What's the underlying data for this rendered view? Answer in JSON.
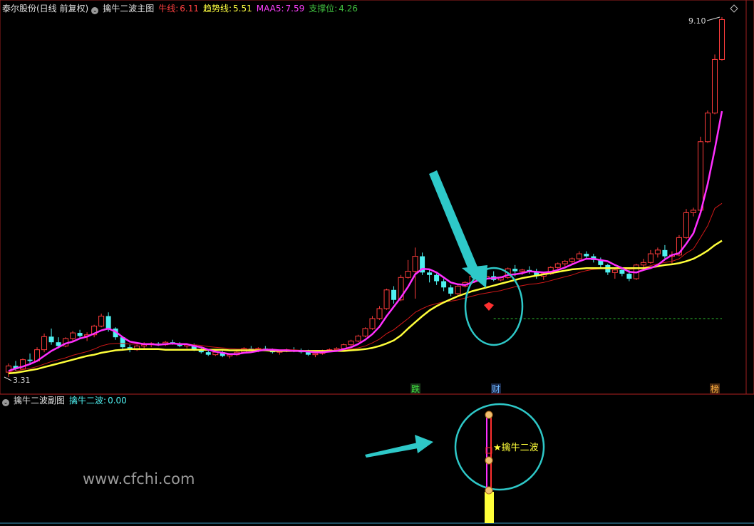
{
  "main_header": {
    "stock": "泰尔股份(日线 前复权)",
    "indicator": "擒牛二波主图",
    "niu_label": "牛线:",
    "niu_value": "6.11",
    "trend_label": "趋势线:",
    "trend_value": "5.51",
    "maa5_label": "MAA5:",
    "maa5_value": "7.59",
    "support_label": "支撑位:",
    "support_value": "4.26"
  },
  "sub_header": {
    "indicator": "擒牛二波副图",
    "value_label": "擒牛二波:",
    "value": "0.00"
  },
  "annotations": {
    "high_label": "9.10",
    "low_label": "3.31",
    "marker_die": "跌",
    "marker_cai": "财",
    "marker_bang": "榜",
    "star_label": "★擒牛二波"
  },
  "watermark": "www.cfchi.com",
  "colors": {
    "up": "#ff3c3c",
    "down": "#4ff0f0",
    "maa5": "#ff2fff",
    "trend": "#ffff3a",
    "niu": "#d01818",
    "support": "#30c030",
    "circle": "#2ec8c8"
  },
  "chart_data": {
    "type": "candlestick",
    "price_range": [
      3.31,
      9.1
    ],
    "support_level": 4.26,
    "ohlc": [
      [
        3.4,
        3.54,
        3.32,
        3.5
      ],
      [
        3.5,
        3.58,
        3.42,
        3.45
      ],
      [
        3.45,
        3.62,
        3.44,
        3.6
      ],
      [
        3.6,
        3.7,
        3.52,
        3.58
      ],
      [
        3.58,
        3.8,
        3.56,
        3.76
      ],
      [
        3.76,
        4.02,
        3.72,
        3.97
      ],
      [
        3.97,
        4.1,
        3.84,
        3.88
      ],
      [
        3.88,
        3.96,
        3.78,
        3.82
      ],
      [
        3.82,
        3.96,
        3.8,
        3.94
      ],
      [
        3.94,
        4.06,
        3.9,
        4.03
      ],
      [
        4.03,
        4.08,
        3.94,
        3.98
      ],
      [
        3.98,
        4.04,
        3.9,
        4.0
      ],
      [
        4.0,
        4.16,
        3.96,
        4.14
      ],
      [
        4.14,
        4.34,
        4.12,
        4.3
      ],
      [
        4.3,
        4.36,
        4.05,
        4.1
      ],
      [
        4.1,
        4.12,
        3.92,
        3.96
      ],
      [
        3.96,
        3.98,
        3.76,
        3.8
      ],
      [
        3.8,
        3.84,
        3.72,
        3.76
      ],
      [
        3.76,
        3.84,
        3.74,
        3.82
      ],
      [
        3.82,
        3.88,
        3.78,
        3.84
      ],
      [
        3.84,
        3.88,
        3.8,
        3.86
      ],
      [
        3.86,
        3.88,
        3.82,
        3.84
      ],
      [
        3.84,
        3.9,
        3.82,
        3.88
      ],
      [
        3.88,
        3.92,
        3.84,
        3.86
      ],
      [
        3.86,
        3.88,
        3.8,
        3.82
      ],
      [
        3.82,
        3.86,
        3.78,
        3.84
      ],
      [
        3.84,
        3.86,
        3.74,
        3.76
      ],
      [
        3.76,
        3.8,
        3.7,
        3.72
      ],
      [
        3.72,
        3.76,
        3.66,
        3.68
      ],
      [
        3.68,
        3.74,
        3.66,
        3.72
      ],
      [
        3.72,
        3.74,
        3.64,
        3.66
      ],
      [
        3.66,
        3.7,
        3.62,
        3.68
      ],
      [
        3.68,
        3.74,
        3.66,
        3.72
      ],
      [
        3.72,
        3.8,
        3.7,
        3.78
      ],
      [
        3.78,
        3.82,
        3.74,
        3.76
      ],
      [
        3.76,
        3.8,
        3.72,
        3.78
      ],
      [
        3.78,
        3.82,
        3.74,
        3.75
      ],
      [
        3.75,
        3.78,
        3.7,
        3.72
      ],
      [
        3.72,
        3.76,
        3.68,
        3.74
      ],
      [
        3.74,
        3.78,
        3.72,
        3.76
      ],
      [
        3.76,
        3.8,
        3.72,
        3.74
      ],
      [
        3.74,
        3.78,
        3.7,
        3.72
      ],
      [
        3.72,
        3.76,
        3.66,
        3.68
      ],
      [
        3.68,
        3.72,
        3.64,
        3.7
      ],
      [
        3.7,
        3.76,
        3.68,
        3.74
      ],
      [
        3.74,
        3.78,
        3.72,
        3.76
      ],
      [
        3.76,
        3.8,
        3.74,
        3.78
      ],
      [
        3.78,
        3.86,
        3.76,
        3.84
      ],
      [
        3.84,
        3.92,
        3.82,
        3.9
      ],
      [
        3.9,
        4.0,
        3.88,
        3.98
      ],
      [
        3.98,
        4.12,
        3.96,
        4.1
      ],
      [
        4.1,
        4.3,
        4.08,
        4.26
      ],
      [
        4.26,
        4.46,
        4.24,
        4.42
      ],
      [
        4.42,
        4.74,
        4.4,
        4.72
      ],
      [
        4.72,
        4.78,
        4.5,
        4.56
      ],
      [
        4.56,
        4.96,
        4.54,
        4.92
      ],
      [
        4.92,
        5.2,
        4.9,
        5.02
      ],
      [
        5.02,
        5.4,
        4.58,
        5.26
      ],
      [
        5.26,
        5.32,
        4.96,
        5.0
      ],
      [
        5.0,
        5.04,
        4.84,
        4.96
      ],
      [
        4.96,
        4.98,
        4.8,
        4.86
      ],
      [
        4.86,
        4.9,
        4.7,
        4.76
      ],
      [
        4.76,
        4.8,
        4.62,
        4.66
      ],
      [
        4.66,
        4.8,
        4.64,
        4.78
      ],
      [
        4.78,
        4.86,
        4.76,
        4.84
      ],
      [
        4.84,
        4.96,
        4.82,
        4.94
      ],
      [
        4.94,
        4.98,
        4.86,
        4.9
      ],
      [
        4.9,
        4.96,
        4.88,
        4.94
      ],
      [
        4.94,
        5.02,
        4.86,
        4.88
      ],
      [
        4.88,
        4.94,
        4.86,
        4.92
      ],
      [
        4.92,
        5.08,
        4.9,
        5.06
      ],
      [
        5.06,
        5.12,
        4.94,
        5.02
      ],
      [
        5.02,
        5.06,
        4.96,
        5.04
      ],
      [
        5.04,
        5.1,
        4.98,
        5.02
      ],
      [
        5.02,
        5.06,
        4.9,
        4.94
      ],
      [
        4.94,
        5.0,
        4.88,
        4.98
      ],
      [
        4.98,
        5.1,
        4.96,
        5.08
      ],
      [
        5.08,
        5.16,
        5.06,
        5.14
      ],
      [
        5.14,
        5.2,
        5.1,
        5.18
      ],
      [
        5.18,
        5.24,
        5.14,
        5.22
      ],
      [
        5.22,
        5.34,
        5.2,
        5.3
      ],
      [
        5.3,
        5.34,
        5.22,
        5.26
      ],
      [
        5.26,
        5.3,
        5.16,
        5.2
      ],
      [
        5.2,
        5.24,
        5.08,
        5.12
      ],
      [
        5.12,
        5.14,
        4.96,
        5.0
      ],
      [
        5.0,
        5.08,
        4.9,
        5.04
      ],
      [
        5.04,
        5.08,
        4.94,
        4.98
      ],
      [
        4.98,
        5.04,
        4.86,
        4.9
      ],
      [
        4.9,
        5.14,
        4.88,
        5.12
      ],
      [
        5.12,
        5.22,
        5.08,
        5.16
      ],
      [
        5.16,
        5.36,
        5.14,
        5.3
      ],
      [
        5.3,
        5.4,
        5.24,
        5.36
      ],
      [
        5.36,
        5.44,
        5.2,
        5.26
      ],
      [
        5.26,
        5.34,
        5.14,
        5.28
      ],
      [
        5.28,
        5.6,
        5.26,
        5.56
      ],
      [
        5.56,
        6.02,
        5.54,
        5.96
      ],
      [
        5.96,
        6.04,
        5.9,
        6.0
      ],
      [
        6.0,
        7.18,
        5.98,
        7.1
      ],
      [
        7.1,
        7.6,
        7.08,
        7.56
      ],
      [
        7.56,
        8.5,
        7.54,
        8.42
      ],
      [
        8.42,
        9.1,
        8.4,
        9.06
      ]
    ],
    "niu_line": [
      3.4,
      3.42,
      3.44,
      3.46,
      3.49,
      3.53,
      3.57,
      3.6,
      3.63,
      3.67,
      3.7,
      3.73,
      3.77,
      3.82,
      3.85,
      3.86,
      3.86,
      3.85,
      3.85,
      3.85,
      3.85,
      3.85,
      3.85,
      3.85,
      3.85,
      3.85,
      3.84,
      3.83,
      3.81,
      3.8,
      3.79,
      3.78,
      3.77,
      3.77,
      3.77,
      3.77,
      3.77,
      3.77,
      3.76,
      3.76,
      3.76,
      3.75,
      3.74,
      3.74,
      3.74,
      3.74,
      3.74,
      3.75,
      3.77,
      3.79,
      3.82,
      3.87,
      3.93,
      4.02,
      4.08,
      4.17,
      4.26,
      4.36,
      4.42,
      4.47,
      4.5,
      4.53,
      4.54,
      4.56,
      4.59,
      4.62,
      4.65,
      4.67,
      4.69,
      4.71,
      4.74,
      4.77,
      4.79,
      4.81,
      4.82,
      4.84,
      4.87,
      4.9,
      4.93,
      4.96,
      5.0,
      5.03,
      5.05,
      5.06,
      5.06,
      5.06,
      5.06,
      5.05,
      5.06,
      5.08,
      5.11,
      5.14,
      5.16,
      5.18,
      5.22,
      5.31,
      5.38,
      5.56,
      5.75,
      6.03,
      6.11
    ],
    "trend_line": [
      3.38,
      3.39,
      3.41,
      3.43,
      3.45,
      3.48,
      3.51,
      3.54,
      3.57,
      3.6,
      3.63,
      3.66,
      3.68,
      3.71,
      3.73,
      3.75,
      3.76,
      3.77,
      3.77,
      3.77,
      3.77,
      3.77,
      3.76,
      3.76,
      3.76,
      3.76,
      3.76,
      3.76,
      3.76,
      3.76,
      3.76,
      3.75,
      3.75,
      3.75,
      3.75,
      3.75,
      3.75,
      3.74,
      3.74,
      3.74,
      3.74,
      3.74,
      3.74,
      3.74,
      3.74,
      3.74,
      3.74,
      3.74,
      3.75,
      3.76,
      3.77,
      3.79,
      3.82,
      3.86,
      3.91,
      3.99,
      4.1,
      4.2,
      4.3,
      4.39,
      4.46,
      4.52,
      4.57,
      4.62,
      4.66,
      4.7,
      4.73,
      4.76,
      4.79,
      4.82,
      4.85,
      4.88,
      4.91,
      4.93,
      4.95,
      4.97,
      4.99,
      5.01,
      5.03,
      5.05,
      5.06,
      5.07,
      5.07,
      5.07,
      5.07,
      5.07,
      5.07,
      5.07,
      5.07,
      5.07,
      5.08,
      5.1,
      5.12,
      5.13,
      5.15,
      5.18,
      5.22,
      5.28,
      5.35,
      5.44,
      5.51
    ],
    "maa5_line": [
      3.42,
      3.46,
      3.49,
      3.53,
      3.58,
      3.66,
      3.74,
      3.8,
      3.86,
      3.89,
      3.94,
      3.97,
      4.02,
      4.07,
      4.1,
      4.05,
      3.96,
      3.89,
      3.87,
      3.85,
      3.85,
      3.84,
      3.85,
      3.86,
      3.85,
      3.85,
      3.82,
      3.8,
      3.76,
      3.73,
      3.71,
      3.69,
      3.69,
      3.71,
      3.72,
      3.74,
      3.76,
      3.76,
      3.75,
      3.75,
      3.74,
      3.74,
      3.73,
      3.72,
      3.72,
      3.73,
      3.74,
      3.77,
      3.8,
      3.85,
      3.92,
      4.01,
      4.13,
      4.3,
      4.45,
      4.6,
      4.77,
      4.97,
      5.06,
      5.05,
      5.0,
      4.92,
      4.84,
      4.81,
      4.8,
      4.84,
      4.88,
      4.9,
      4.91,
      4.92,
      4.96,
      4.97,
      4.99,
      5.02,
      5.01,
      5.0,
      5.01,
      5.04,
      5.08,
      5.13,
      5.18,
      5.22,
      5.22,
      5.2,
      5.18,
      5.12,
      5.07,
      5.01,
      5.0,
      5.04,
      5.07,
      5.12,
      5.21,
      5.28,
      5.31,
      5.46,
      5.63,
      5.96,
      6.42,
      6.98,
      7.59
    ]
  }
}
